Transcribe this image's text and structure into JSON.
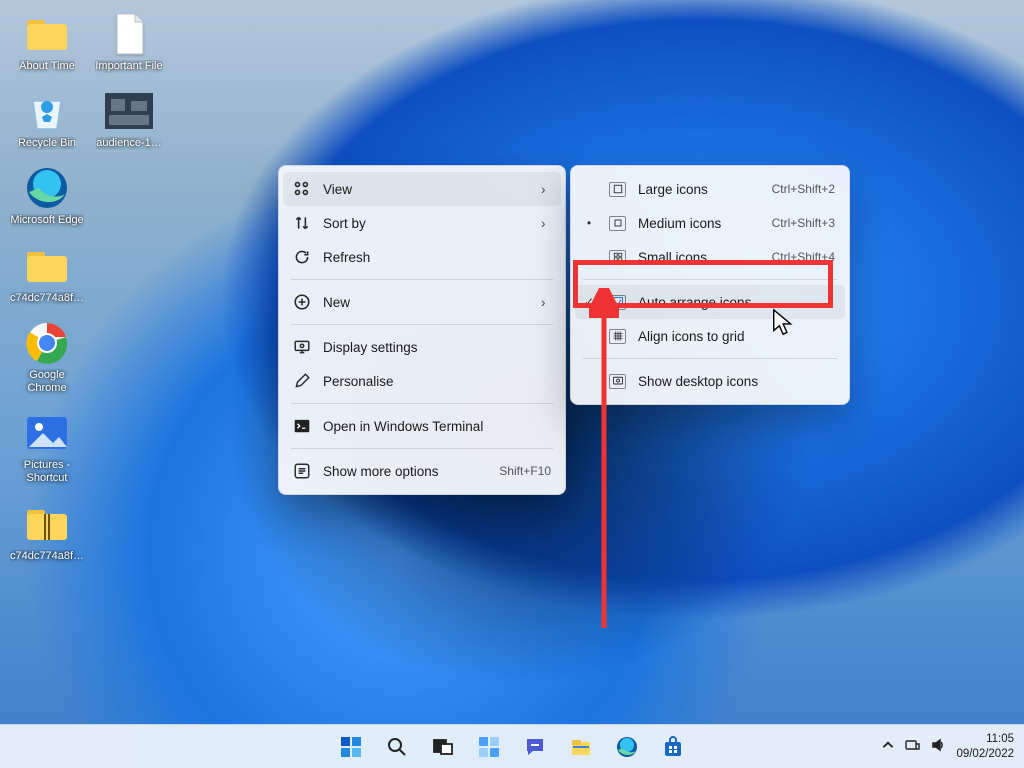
{
  "desktop_icons": {
    "col1": [
      {
        "name": "about-time",
        "label": "About Time"
      },
      {
        "name": "recycle-bin",
        "label": "Recycle Bin"
      },
      {
        "name": "microsoft-edge",
        "label": "Microsoft Edge"
      },
      {
        "name": "folder-c74-a",
        "label": "c74dc774a8f…"
      },
      {
        "name": "google-chrome",
        "label": "Google Chrome"
      },
      {
        "name": "pictures-shortcut",
        "label": "Pictures - Shortcut"
      },
      {
        "name": "folder-c74-b",
        "label": "c74dc774a8f…"
      }
    ],
    "col2": [
      {
        "name": "important-file",
        "label": "Important File"
      },
      {
        "name": "audience-photo",
        "label": "audience-1…"
      }
    ]
  },
  "context_menu": {
    "items": [
      {
        "icon": "grid",
        "label": "View",
        "arrow": true,
        "hover": true
      },
      {
        "icon": "sort",
        "label": "Sort by",
        "arrow": true
      },
      {
        "icon": "refresh",
        "label": "Refresh"
      },
      {
        "sep": true
      },
      {
        "icon": "new",
        "label": "New",
        "arrow": true
      },
      {
        "sep": true
      },
      {
        "icon": "display",
        "label": "Display settings"
      },
      {
        "icon": "personalise",
        "label": "Personalise"
      },
      {
        "sep": true
      },
      {
        "icon": "terminal",
        "label": "Open in Windows Terminal"
      },
      {
        "sep": true
      },
      {
        "icon": "more",
        "label": "Show more options",
        "shortcut": "Shift+F10"
      }
    ]
  },
  "submenu": {
    "items": [
      {
        "mark": "",
        "icon": "large",
        "label": "Large icons",
        "shortcut": "Ctrl+Shift+2"
      },
      {
        "mark": "•",
        "icon": "medium",
        "label": "Medium icons",
        "shortcut": "Ctrl+Shift+3"
      },
      {
        "mark": "",
        "icon": "small",
        "label": "Small icons",
        "shortcut": "Ctrl+Shift+4"
      },
      {
        "sep": true
      },
      {
        "mark": "✓",
        "icon": "auto",
        "label": "Auto arrange icons",
        "hover": true
      },
      {
        "mark": "",
        "icon": "align",
        "label": "Align icons to grid"
      },
      {
        "sep": true
      },
      {
        "mark": "",
        "icon": "show",
        "label": "Show desktop icons"
      }
    ]
  },
  "taskbar": {
    "items": [
      "start",
      "search",
      "taskview",
      "widgets",
      "chat",
      "explorer",
      "edge",
      "store"
    ]
  },
  "tray": {
    "time": "11:05",
    "date": "09/02/2022"
  }
}
